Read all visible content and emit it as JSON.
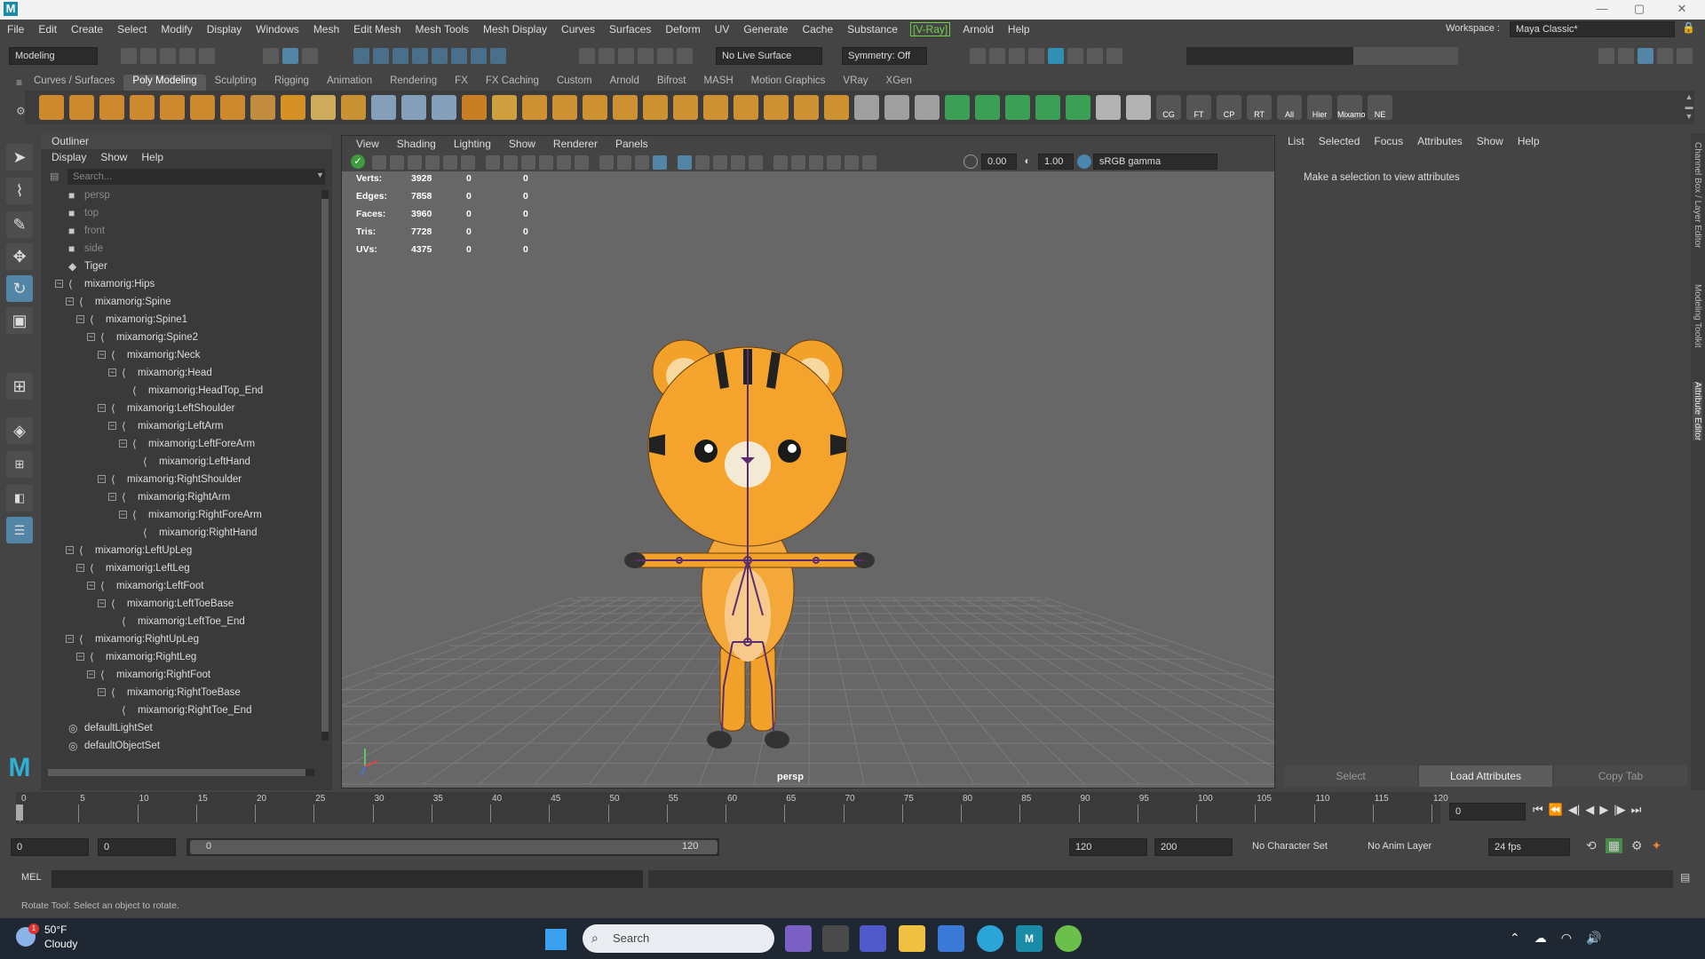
{
  "window": {
    "minimize": "—",
    "maximize": "▢",
    "close": "✕"
  },
  "menubar": [
    "File",
    "Edit",
    "Create",
    "Select",
    "Modify",
    "Display",
    "Windows",
    "Mesh",
    "Edit Mesh",
    "Mesh Tools",
    "Mesh Display",
    "Curves",
    "Surfaces",
    "Deform",
    "UV",
    "Generate",
    "Cache",
    "Substance",
    "[V-Ray]",
    "Arnold",
    "Help"
  ],
  "workspace": {
    "label": "Workspace :",
    "value": "Maya Classic*"
  },
  "statusline": {
    "mode": "Modeling",
    "live_surface": "No Live Surface",
    "symmetry": "Symmetry: Off"
  },
  "shelf_tabs": [
    "Curves / Surfaces",
    "Poly Modeling",
    "Sculpting",
    "Rigging",
    "Animation",
    "Rendering",
    "FX",
    "FX Caching",
    "Custom",
    "Arnold",
    "Bifrost",
    "MASH",
    "Motion Graphics",
    "VRay",
    "XGen"
  ],
  "shelf_labels": [
    "CG",
    "FT",
    "CP",
    "RT",
    "All",
    "Hier",
    "Mixamo",
    "NE"
  ],
  "outliner": {
    "title": "Outliner",
    "menus": [
      "Display",
      "Show",
      "Help"
    ],
    "search_placeholder": "Search...",
    "rows": [
      {
        "label": "persp",
        "indent": 0,
        "type": "cam",
        "grey": true
      },
      {
        "label": "top",
        "indent": 0,
        "type": "cam",
        "grey": true
      },
      {
        "label": "front",
        "indent": 0,
        "type": "cam",
        "grey": true
      },
      {
        "label": "side",
        "indent": 0,
        "type": "cam",
        "grey": true
      },
      {
        "label": "Tiger",
        "indent": 0,
        "type": "mesh"
      },
      {
        "label": "mixamorig:Hips",
        "indent": 0,
        "type": "joint",
        "exp": true
      },
      {
        "label": "mixamorig:Spine",
        "indent": 1,
        "type": "joint",
        "exp": true
      },
      {
        "label": "mixamorig:Spine1",
        "indent": 2,
        "type": "joint",
        "exp": true
      },
      {
        "label": "mixamorig:Spine2",
        "indent": 3,
        "type": "joint",
        "exp": true
      },
      {
        "label": "mixamorig:Neck",
        "indent": 4,
        "type": "joint",
        "exp": true
      },
      {
        "label": "mixamorig:Head",
        "indent": 5,
        "type": "joint",
        "exp": true
      },
      {
        "label": "mixamorig:HeadTop_End",
        "indent": 6,
        "type": "joint"
      },
      {
        "label": "mixamorig:LeftShoulder",
        "indent": 4,
        "type": "joint",
        "exp": true
      },
      {
        "label": "mixamorig:LeftArm",
        "indent": 5,
        "type": "joint",
        "exp": true
      },
      {
        "label": "mixamorig:LeftForeArm",
        "indent": 6,
        "type": "joint",
        "exp": true
      },
      {
        "label": "mixamorig:LeftHand",
        "indent": 7,
        "type": "joint"
      },
      {
        "label": "mixamorig:RightShoulder",
        "indent": 4,
        "type": "joint",
        "exp": true
      },
      {
        "label": "mixamorig:RightArm",
        "indent": 5,
        "type": "joint",
        "exp": true
      },
      {
        "label": "mixamorig:RightForeArm",
        "indent": 6,
        "type": "joint",
        "exp": true
      },
      {
        "label": "mixamorig:RightHand",
        "indent": 7,
        "type": "joint"
      },
      {
        "label": "mixamorig:LeftUpLeg",
        "indent": 1,
        "type": "joint",
        "exp": true
      },
      {
        "label": "mixamorig:LeftLeg",
        "indent": 2,
        "type": "joint",
        "exp": true
      },
      {
        "label": "mixamorig:LeftFoot",
        "indent": 3,
        "type": "joint",
        "exp": true
      },
      {
        "label": "mixamorig:LeftToeBase",
        "indent": 4,
        "type": "joint",
        "exp": true
      },
      {
        "label": "mixamorig:LeftToe_End",
        "indent": 5,
        "type": "joint"
      },
      {
        "label": "mixamorig:RightUpLeg",
        "indent": 1,
        "type": "joint",
        "exp": true
      },
      {
        "label": "mixamorig:RightLeg",
        "indent": 2,
        "type": "joint",
        "exp": true
      },
      {
        "label": "mixamorig:RightFoot",
        "indent": 3,
        "type": "joint",
        "exp": true
      },
      {
        "label": "mixamorig:RightToeBase",
        "indent": 4,
        "type": "joint",
        "exp": true
      },
      {
        "label": "mixamorig:RightToe_End",
        "indent": 5,
        "type": "joint"
      },
      {
        "label": "defaultLightSet",
        "indent": 0,
        "type": "set"
      },
      {
        "label": "defaultObjectSet",
        "indent": 0,
        "type": "set"
      }
    ]
  },
  "viewport": {
    "menus": [
      "View",
      "Shading",
      "Lighting",
      "Show",
      "Renderer",
      "Panels"
    ],
    "field_a": "0.00",
    "field_b": "1.00",
    "color_space": "sRGB gamma",
    "camera_label": "persp",
    "hud": [
      {
        "name": "Verts:",
        "v": "3928",
        "a": "0",
        "b": "0"
      },
      {
        "name": "Edges:",
        "v": "7858",
        "a": "0",
        "b": "0"
      },
      {
        "name": "Faces:",
        "v": "3960",
        "a": "0",
        "b": "0"
      },
      {
        "name": "Tris:",
        "v": "7728",
        "a": "0",
        "b": "0"
      },
      {
        "name": "UVs:",
        "v": "4375",
        "a": "0",
        "b": "0"
      }
    ]
  },
  "attribute_editor": {
    "menus": [
      "List",
      "Selected",
      "Focus",
      "Attributes",
      "Show",
      "Help"
    ],
    "message": "Make a selection to view attributes",
    "buttons": [
      "Select",
      "Load Attributes",
      "Copy Tab"
    ],
    "side_tabs": [
      "Channel Box / Layer Editor",
      "Modeling Toolkit",
      "Attribute Editor"
    ]
  },
  "timeline": {
    "ticks": [
      "0",
      "5",
      "10",
      "15",
      "20",
      "25",
      "30",
      "35",
      "40",
      "45",
      "50",
      "55",
      "60",
      "65",
      "70",
      "75",
      "80",
      "85",
      "90",
      "95",
      "100",
      "105",
      "110",
      "115",
      "120"
    ],
    "current_frame": "0"
  },
  "range": {
    "start": "0",
    "inner_start": "0",
    "slider_start": "0",
    "slider_end": "120",
    "end": "120",
    "outer_end": "200",
    "character_set": "No Character Set",
    "anim_layer": "No Anim Layer",
    "fps": "24 fps"
  },
  "cmdline": {
    "label": "MEL"
  },
  "helpline": "Rotate Tool: Select an object to rotate.",
  "taskbar": {
    "temperature": "50°F",
    "weather": "Cloudy",
    "badge": "1",
    "search": "Search"
  },
  "colors": {
    "accent": "#5285a6",
    "vray": "#6fcf4a",
    "tiger": "#f0a020",
    "skeleton": "#5a2d6e"
  }
}
